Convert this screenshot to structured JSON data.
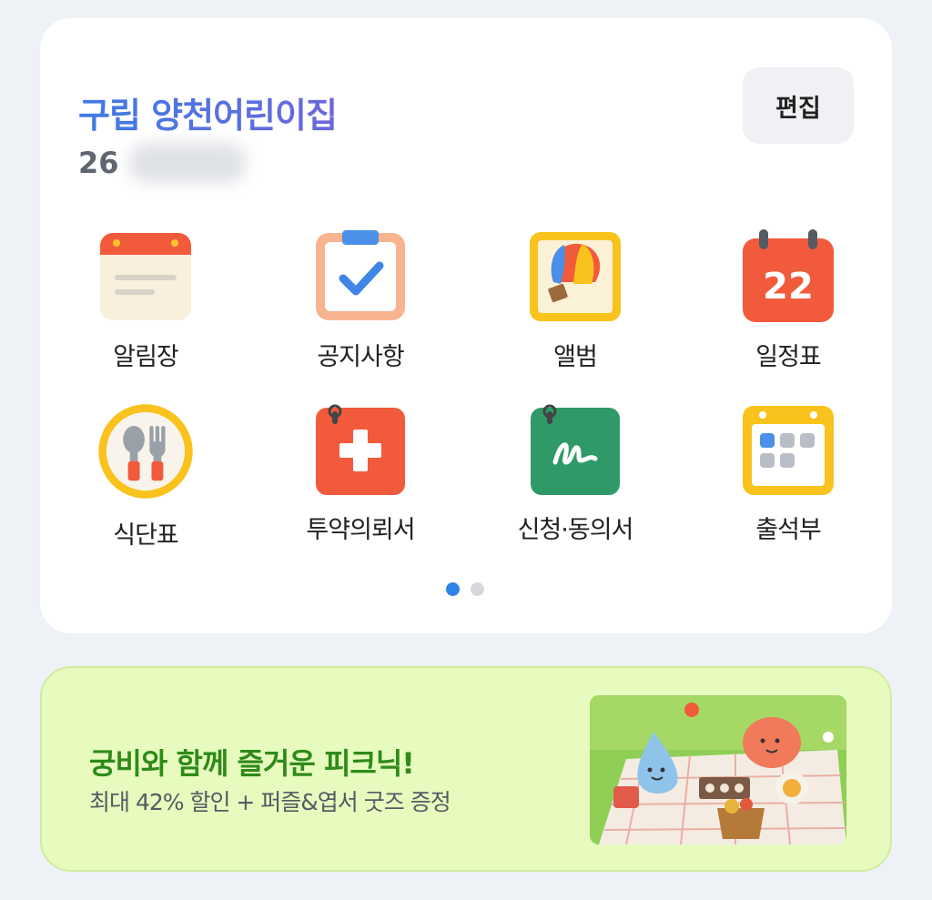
{
  "header": {
    "title": "구립 양천어린이집",
    "subtitle_prefix": "26",
    "edit_label": "편집"
  },
  "menu": {
    "items": [
      {
        "label": "알림장",
        "icon": "notice-note-icon"
      },
      {
        "label": "공지사항",
        "icon": "announcement-checklist-icon"
      },
      {
        "label": "앨범",
        "icon": "album-balloon-icon"
      },
      {
        "label": "일정표",
        "icon": "schedule-calendar-icon"
      },
      {
        "label": "식단표",
        "icon": "meal-plan-icon"
      },
      {
        "label": "투약의뢰서",
        "icon": "medication-request-icon"
      },
      {
        "label": "신청·동의서",
        "icon": "application-consent-icon"
      },
      {
        "label": "출석부",
        "icon": "attendance-icon"
      }
    ],
    "calendar_day": "22"
  },
  "pagination": {
    "pages": 2,
    "current": 1
  },
  "banner": {
    "title": "궁비와 함께 즐거운 피크닉!",
    "subtitle": "최대 42% 할인 + 퍼즐&엽서 굿즈 증정"
  },
  "colors": {
    "accent": "#2f84ea",
    "title_gradient_start": "#3f7be6",
    "title_gradient_end": "#6c67db",
    "banner_bg": "#e6fbbd",
    "banner_title": "#2f8a1a"
  }
}
